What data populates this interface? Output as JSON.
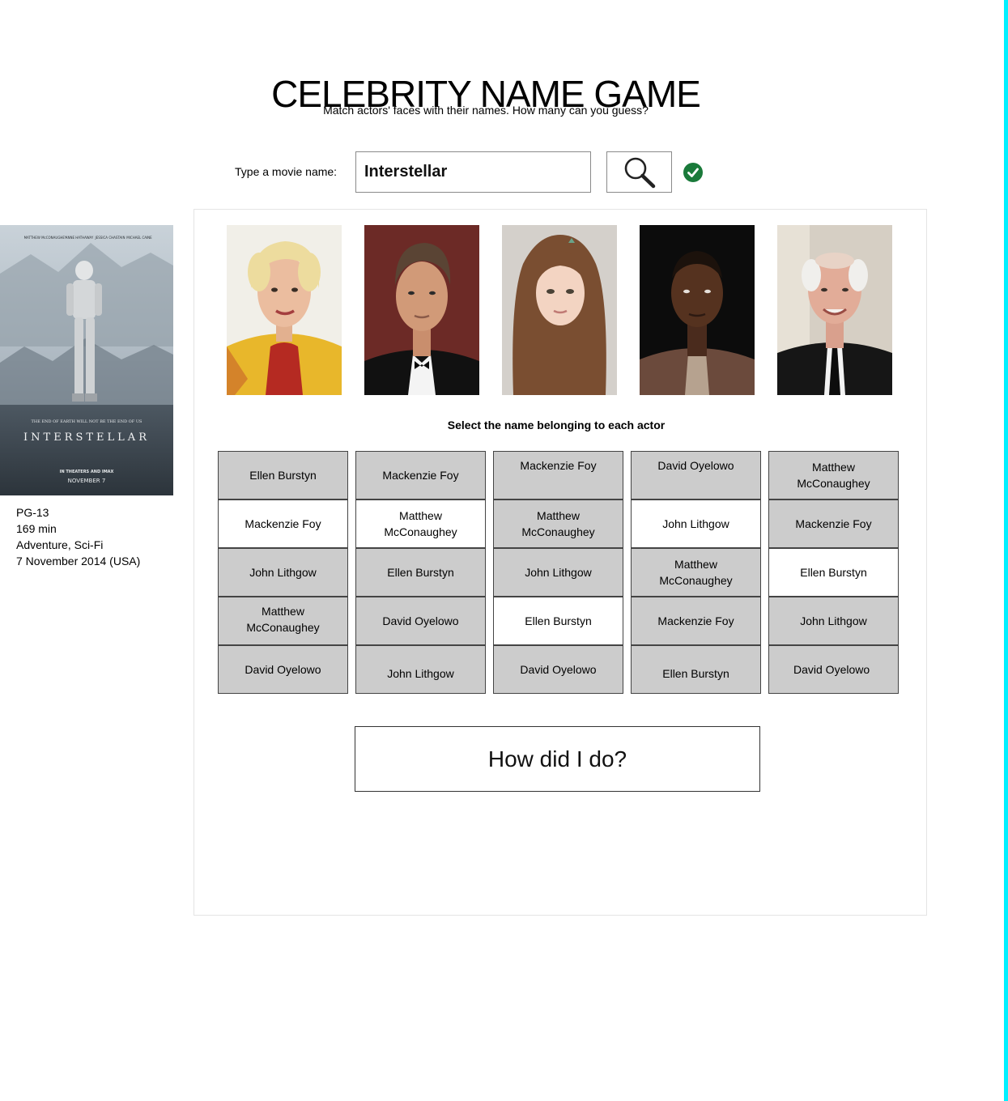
{
  "header": {
    "title": "CELEBRITY NAME GAME",
    "subtitle": "Match actors' faces with their names. How many can you guess?"
  },
  "search": {
    "label": "Type a movie name:",
    "value": "Interstellar",
    "button_icon": "magnifier-icon",
    "status_icon": "check-circle-icon",
    "status_color": "#1a7a3a"
  },
  "movie": {
    "poster": {
      "cast_names": [
        "MATTHEW McCONAUGHEY",
        "ANNE HATHAWAY",
        "JESSICA CHASTAIN",
        "MICHAEL CAINE"
      ],
      "tagline": "THE END OF EARTH WILL NOT BE THE END OF US",
      "title": "INTERSTELLAR",
      "release_line": "IN THEATERS AND IMAX",
      "date_line": "NOVEMBER 7"
    },
    "rating": "PG-13",
    "runtime": "169 min",
    "genre": "Adventure, Sci-Fi",
    "release": "7 November 2014 (USA)"
  },
  "game": {
    "instructions": "Select the name belonging to each actor",
    "actor_photos": [
      "actor-photo-1",
      "actor-photo-2",
      "actor-photo-3",
      "actor-photo-4",
      "actor-photo-5"
    ],
    "columns": [
      {
        "options": [
          {
            "label": "Ellen Burstyn",
            "selected": false
          },
          {
            "label": "Mackenzie Foy",
            "selected": true
          },
          {
            "label": "John Lithgow",
            "selected": false
          },
          {
            "label": "Matthew McConaughey",
            "selected": false
          },
          {
            "label": "David Oyelowo",
            "selected": false
          }
        ]
      },
      {
        "options": [
          {
            "label": "Mackenzie Foy",
            "selected": false
          },
          {
            "label": "Matthew McConaughey",
            "selected": true
          },
          {
            "label": "Ellen Burstyn",
            "selected": false
          },
          {
            "label": "David Oyelowo",
            "selected": false
          },
          {
            "label": "John Lithgow",
            "selected": false
          }
        ]
      },
      {
        "options": [
          {
            "label": "Mackenzie Foy",
            "selected": false
          },
          {
            "label": "Matthew McConaughey",
            "selected": false
          },
          {
            "label": "John Lithgow",
            "selected": false
          },
          {
            "label": "Ellen Burstyn",
            "selected": true
          },
          {
            "label": "David Oyelowo",
            "selected": false
          }
        ]
      },
      {
        "options": [
          {
            "label": "David Oyelowo",
            "selected": false
          },
          {
            "label": "John Lithgow",
            "selected": true
          },
          {
            "label": "Matthew McConaughey",
            "selected": false
          },
          {
            "label": "Mackenzie Foy",
            "selected": false
          },
          {
            "label": "Ellen Burstyn",
            "selected": false
          }
        ]
      },
      {
        "options": [
          {
            "label": "Matthew McConaughey",
            "selected": false
          },
          {
            "label": "Mackenzie Foy",
            "selected": false
          },
          {
            "label": "Ellen Burstyn",
            "selected": true
          },
          {
            "label": "John Lithgow",
            "selected": false
          },
          {
            "label": "David Oyelowo",
            "selected": false
          }
        ]
      }
    ],
    "submit_label": "How did I do?"
  }
}
